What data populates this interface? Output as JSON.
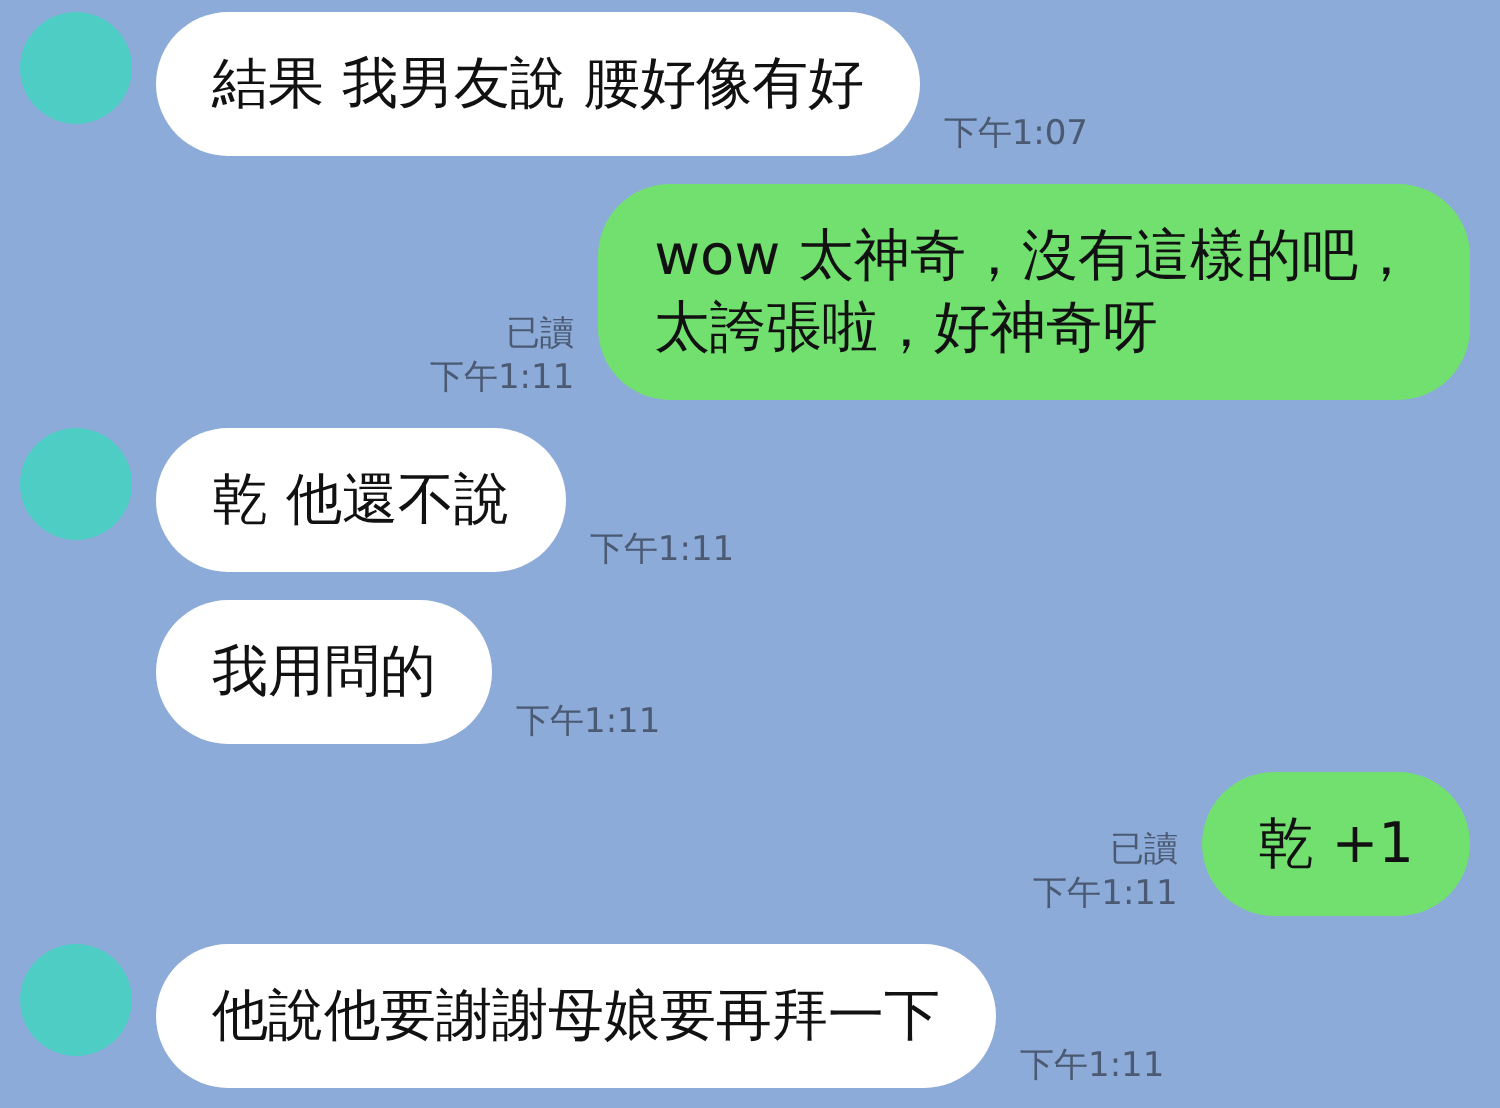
{
  "messages": [
    {
      "kind": "received",
      "avatar": true,
      "lines": [
        "結果 我男友說 腰好像有好"
      ],
      "time": "下午1:07"
    },
    {
      "kind": "sent",
      "lines": [
        "wow 太神奇，沒有這樣的吧，",
        "太誇張啦，好神奇呀"
      ],
      "read": "已讀",
      "time": "下午1:11"
    },
    {
      "kind": "received",
      "avatar": true,
      "lines": [
        "乾 他還不說"
      ],
      "time": "下午1:11"
    },
    {
      "kind": "received",
      "avatar": false,
      "lines": [
        "我用問的"
      ],
      "time": "下午1:11"
    },
    {
      "kind": "sent",
      "lines": [
        "乾 +1"
      ],
      "read": "已讀",
      "time": "下午1:11"
    },
    {
      "kind": "received",
      "avatar": true,
      "lines": [
        "他說他要謝謝母娘要再拜一下"
      ],
      "time": "下午1:11"
    }
  ]
}
